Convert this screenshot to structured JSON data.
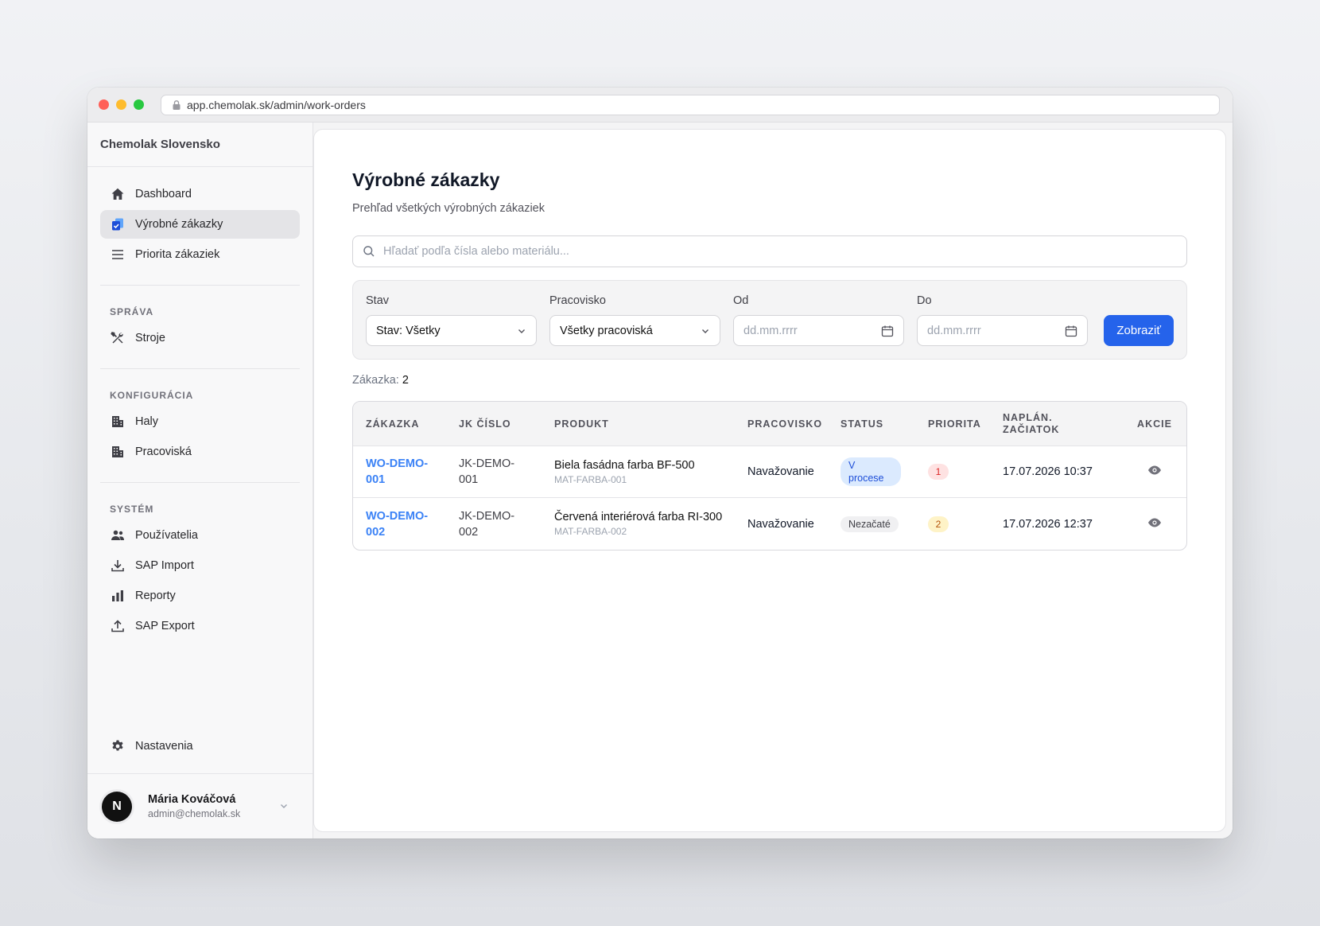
{
  "browser": {
    "url": "app.chemolak.sk/admin/work-orders"
  },
  "sidebar": {
    "brand": "Chemolak Slovensko",
    "main_items": [
      {
        "label": "Dashboard",
        "icon": "home-icon"
      },
      {
        "label": "Výrobné zákazky",
        "icon": "clipboard-check-icon",
        "active": true
      },
      {
        "label": "Priorita zákaziek",
        "icon": "list-icon"
      }
    ],
    "sections": [
      {
        "title": "SPRÁVA",
        "items": [
          {
            "label": "Stroje",
            "icon": "tools-icon"
          }
        ]
      },
      {
        "title": "KONFIGURÁCIA",
        "items": [
          {
            "label": "Haly",
            "icon": "building-icon"
          },
          {
            "label": "Pracoviská",
            "icon": "building-icon"
          }
        ]
      },
      {
        "title": "SYSTÉM",
        "items": [
          {
            "label": "Používatelia",
            "icon": "users-icon"
          },
          {
            "label": "SAP Import",
            "icon": "download-icon"
          },
          {
            "label": "Reporty",
            "icon": "bar-chart-icon"
          },
          {
            "label": "SAP Export",
            "icon": "upload-icon"
          }
        ]
      }
    ],
    "settings_label": "Nastavenia",
    "user": {
      "avatar_letter": "N",
      "name": "Mária Kováčová",
      "email": "admin@chemolak.sk"
    }
  },
  "page": {
    "title": "Výrobné zákazky",
    "subtitle": "Prehľad všetkých výrobných zákaziek",
    "search_placeholder": "Hľadať podľa čísla alebo materiálu..."
  },
  "filters": {
    "status": {
      "label": "Stav",
      "value": "Stav: Všetky"
    },
    "workplace": {
      "label": "Pracovisko",
      "value": "Všetky pracoviská"
    },
    "from": {
      "label": "Od",
      "placeholder": "dd.mm.rrrr"
    },
    "to": {
      "label": "Do",
      "placeholder": "dd.mm.rrrr"
    },
    "submit_label": "Zobraziť"
  },
  "count": {
    "label": "Zákazka:",
    "value": "2"
  },
  "table": {
    "columns": [
      "ZÁKAZKA",
      "JK ČÍSLO",
      "PRODUKT",
      "PRACOVISKO",
      "STATUS",
      "PRIORITA",
      "NAPLÁN. ZAČIATOK",
      "AKCIE"
    ],
    "rows": [
      {
        "order_line1": "WO-DEMO-",
        "order_line2": "001",
        "jk_line1": "JK-DEMO-",
        "jk_line2": "001",
        "product": "Biela fasádna farba BF-500",
        "material": "MAT-FARBA-001",
        "workplace": "Navažovanie",
        "status": "V procese",
        "status_style": "blue",
        "priority": "1",
        "priority_style": "red",
        "planned_start": "17.07.2026 10:37"
      },
      {
        "order_line1": "WO-DEMO-",
        "order_line2": "002",
        "jk_line1": "JK-DEMO-",
        "jk_line2": "002",
        "product": "Červená interiérová farba RI-300",
        "material": "MAT-FARBA-002",
        "workplace": "Navažovanie",
        "status": "Nezačaté",
        "status_style": "gray",
        "priority": "2",
        "priority_style": "amber",
        "planned_start": "17.07.2026 12:37"
      }
    ]
  },
  "colors": {
    "accent": "#2563eb",
    "link": "#3b82f6"
  }
}
